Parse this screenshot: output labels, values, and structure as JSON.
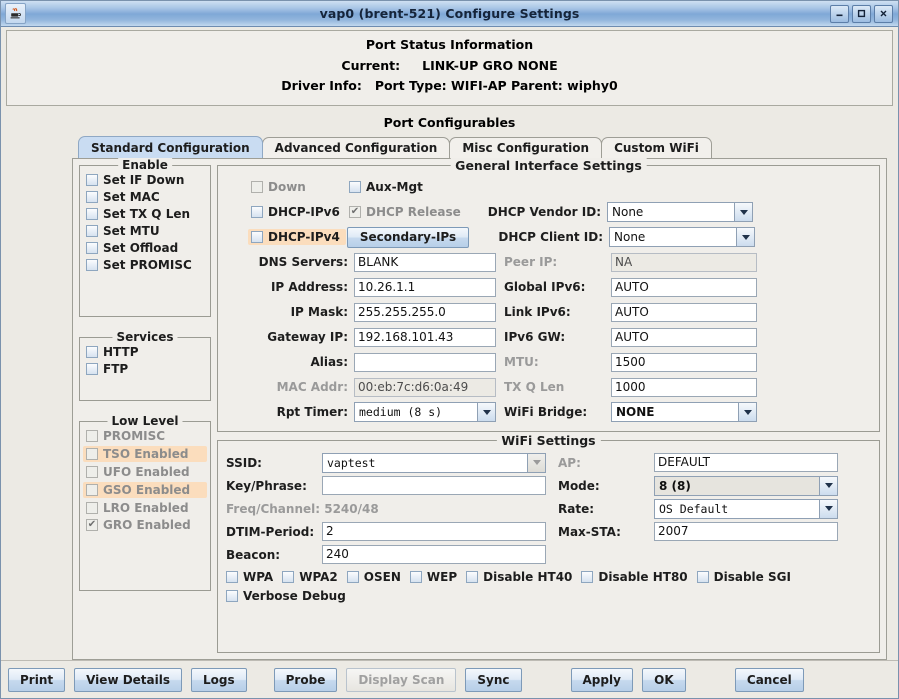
{
  "window": {
    "title": "vap0  (brent-521) Configure Settings",
    "icon": "java-coffee-cup-icon",
    "buttons": {
      "minimize": "_",
      "maximize": "□",
      "close": "✕"
    }
  },
  "status": {
    "title": "Port Status Information",
    "current_label": "Current:",
    "current_value": "LINK-UP GRO  NONE",
    "driver_label": "Driver Info:",
    "driver_value": "Port Type: WIFI-AP   Parent: wiphy0"
  },
  "port_configurables": {
    "title": "Port Configurables",
    "tabs": [
      {
        "label": "Standard Configuration",
        "active": true
      },
      {
        "label": "Advanced Configuration",
        "active": false
      },
      {
        "label": "Misc Configuration",
        "active": false
      },
      {
        "label": "Custom WiFi",
        "active": false
      }
    ]
  },
  "enable_group": {
    "title": "Enable",
    "items": [
      {
        "label": "Set IF Down",
        "checked": false
      },
      {
        "label": "Set MAC",
        "checked": false
      },
      {
        "label": "Set TX Q Len",
        "checked": false
      },
      {
        "label": "Set MTU",
        "checked": false
      },
      {
        "label": "Set Offload",
        "checked": false
      },
      {
        "label": "Set PROMISC",
        "checked": false
      }
    ]
  },
  "services_group": {
    "title": "Services",
    "items": [
      {
        "label": "HTTP",
        "checked": false
      },
      {
        "label": "FTP",
        "checked": false
      }
    ]
  },
  "low_level_group": {
    "title": "Low Level",
    "items": [
      {
        "label": "PROMISC",
        "checked": false
      },
      {
        "label": "TSO Enabled",
        "checked": false
      },
      {
        "label": "UFO Enabled",
        "checked": false
      },
      {
        "label": "GSO Enabled",
        "checked": false
      },
      {
        "label": "LRO Enabled",
        "checked": false
      },
      {
        "label": "GRO Enabled",
        "checked": true
      }
    ]
  },
  "general": {
    "title": "General Interface Settings",
    "down_label": "Down",
    "aux_mgt_label": "Aux-Mgt",
    "dhcp_ipv6_label": "DHCP-IPv6",
    "dhcp_release_label": "DHCP Release",
    "dhcp_ipv4_label": "DHCP-IPv4",
    "secondary_ips_label": "Secondary-IPs",
    "dhcp_vendor_label": "DHCP Vendor ID:",
    "dhcp_vendor_value": "None",
    "dhcp_client_label": "DHCP Client ID:",
    "dhcp_client_value": "None",
    "dns_label": "DNS Servers:",
    "dns_value": "BLANK",
    "peer_ip_label": "Peer IP:",
    "peer_ip_value": "NA",
    "ip_addr_label": "IP Address:",
    "ip_addr_value": "10.26.1.1",
    "global_ipv6_label": "Global IPv6:",
    "global_ipv6_value": "AUTO",
    "ip_mask_label": "IP Mask:",
    "ip_mask_value": "255.255.255.0",
    "link_ipv6_label": "Link IPv6:",
    "link_ipv6_value": "AUTO",
    "gateway_label": "Gateway IP:",
    "gateway_value": "192.168.101.43",
    "ipv6_gw_label": "IPv6 GW:",
    "ipv6_gw_value": "AUTO",
    "alias_label": "Alias:",
    "alias_value": "",
    "mtu_label": "MTU:",
    "mtu_value": "1500",
    "mac_label": "MAC Addr:",
    "mac_value": "00:eb:7c:d6:0a:49",
    "txqlen_label": "TX Q Len",
    "txqlen_value": "1000",
    "rpt_timer_label": "Rpt Timer:",
    "rpt_timer_value": "medium   (8 s)",
    "wifi_bridge_label": "WiFi Bridge:",
    "wifi_bridge_value": "NONE"
  },
  "wifi": {
    "title": "WiFi Settings",
    "ssid_label": "SSID:",
    "ssid_value": "vaptest",
    "ap_label": "AP:",
    "ap_value": "DEFAULT",
    "key_label": "Key/Phrase:",
    "key_value": "",
    "mode_label": "Mode:",
    "mode_value": "8 (8)",
    "freq_label": "Freq/Channel: 5240/48",
    "rate_label": "Rate:",
    "rate_value": "OS Default",
    "dtim_label": "DTIM-Period:",
    "dtim_value": "2",
    "maxsta_label": "Max-STA:",
    "maxsta_value": "2007",
    "beacon_label": "Beacon:",
    "beacon_value": "240",
    "checkboxes": [
      {
        "label": "WPA",
        "checked": false
      },
      {
        "label": "WPA2",
        "checked": false
      },
      {
        "label": "OSEN",
        "checked": false
      },
      {
        "label": "WEP",
        "checked": false
      },
      {
        "label": "Disable HT40",
        "checked": false
      },
      {
        "label": "Disable HT80",
        "checked": false
      },
      {
        "label": "Disable SGI",
        "checked": false
      }
    ],
    "verbose_label": "Verbose Debug"
  },
  "bottom_buttons": [
    {
      "label": "Print",
      "enabled": true
    },
    {
      "label": "View Details",
      "enabled": true
    },
    {
      "label": "Logs",
      "enabled": true
    },
    {
      "label": "Probe",
      "enabled": true
    },
    {
      "label": "Display Scan",
      "enabled": false
    },
    {
      "label": "Sync",
      "enabled": true
    },
    {
      "label": "Apply",
      "enabled": true
    },
    {
      "label": "OK",
      "enabled": true
    },
    {
      "label": "Cancel",
      "enabled": true
    }
  ],
  "colors": {
    "highlight_orange": "#fbddbd",
    "tab_active_blue": "#c9dcf2",
    "panel_bg": "#f0eeea"
  }
}
